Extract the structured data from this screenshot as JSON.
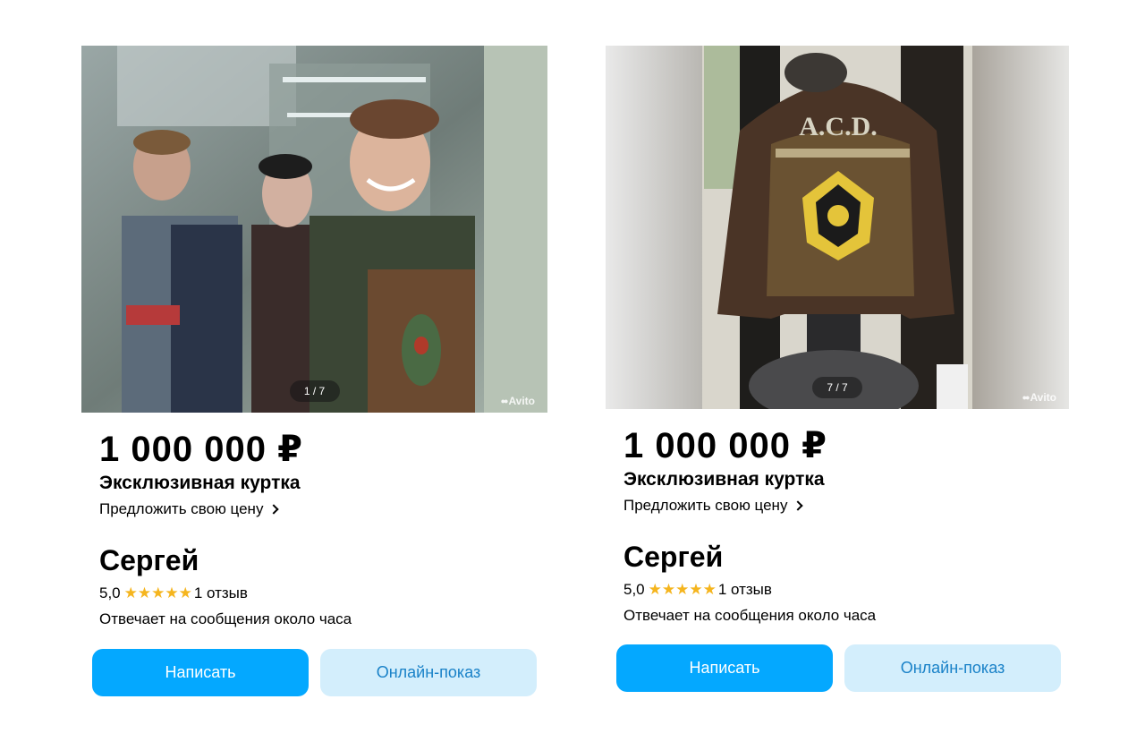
{
  "colors": {
    "primary_button": "#04a8ff",
    "secondary_button": "#d3eefc",
    "secondary_text": "#1a82c8",
    "star": "#f5b51e"
  },
  "listings": [
    {
      "photo_counter": "1 / 7",
      "watermark": "Avito",
      "price": "1 000 000 ₽",
      "title": "Эксклюзивная куртка",
      "offer_link": "Предложить свою цену",
      "seller_name": "Сергей",
      "rating_value": "5,0",
      "stars": "★★★★★",
      "reviews": "1 отзыв",
      "reply_time": "Отвечает на сообщения около часа",
      "write_button": "Написать",
      "online_button": "Онлайн-показ"
    },
    {
      "photo_counter": "7 / 7",
      "watermark": "Avito",
      "price": "1 000 000 ₽",
      "title": "Эксклюзивная куртка",
      "offer_link": "Предложить свою цену",
      "seller_name": "Сергей",
      "rating_value": "5,0",
      "stars": "★★★★★",
      "reviews": "1 отзыв",
      "reply_time": "Отвечает на сообщения около часа",
      "write_button": "Написать",
      "online_button": "Онлайн-показ"
    }
  ]
}
